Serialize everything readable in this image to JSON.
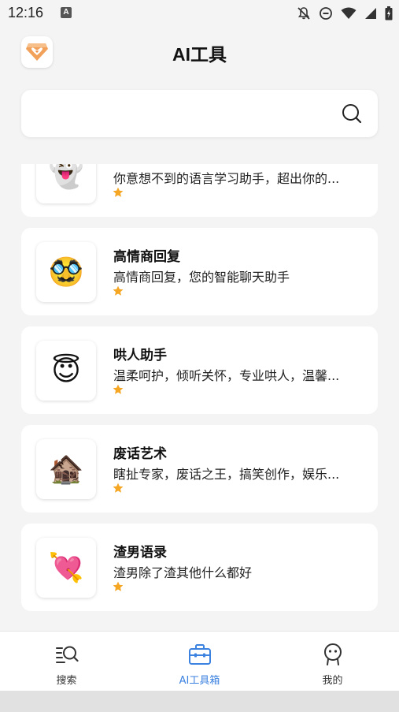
{
  "status_bar": {
    "time": "12:16",
    "notification_letter": "A"
  },
  "header": {
    "title": "AI工具",
    "logo_icon": "heart-shield-logo-icon"
  },
  "search": {
    "value": "",
    "placeholder": ""
  },
  "tools": [
    {
      "icon": "👻",
      "icon_name": "ghost-icon",
      "title": "",
      "description": "你意想不到的语言学习助手，超出你的...",
      "rating": 1
    },
    {
      "icon": "🥸",
      "icon_name": "disguised-face-icon",
      "title": "高情商回复",
      "description": "高情商回复，您的智能聊天助手",
      "rating": 1
    },
    {
      "icon": "😇",
      "icon_name": "halo-face-icon",
      "title": "哄人助手",
      "description": "温柔呵护，倾听关怀，专业哄人，温馨...",
      "rating": 1
    },
    {
      "icon": "🏚️",
      "icon_name": "derelict-house-icon",
      "title": "废话艺术",
      "description": "瞎扯专家，废话之王，搞笑创作，娱乐...",
      "rating": 1
    },
    {
      "icon": "💘",
      "icon_name": "heart-arrow-icon",
      "title": "渣男语录",
      "description": "渣男除了渣其他什么都好",
      "rating": 1
    }
  ],
  "bottom_nav": {
    "items": [
      {
        "label": "搜索",
        "icon": "search-list-icon",
        "active": false
      },
      {
        "label": "AI工具箱",
        "icon": "toolbox-icon",
        "active": true
      },
      {
        "label": "我的",
        "icon": "profile-icon",
        "active": false
      }
    ]
  },
  "colors": {
    "accent": "#3c82e0",
    "star": "#f5a623",
    "background": "#f4f4f4"
  }
}
